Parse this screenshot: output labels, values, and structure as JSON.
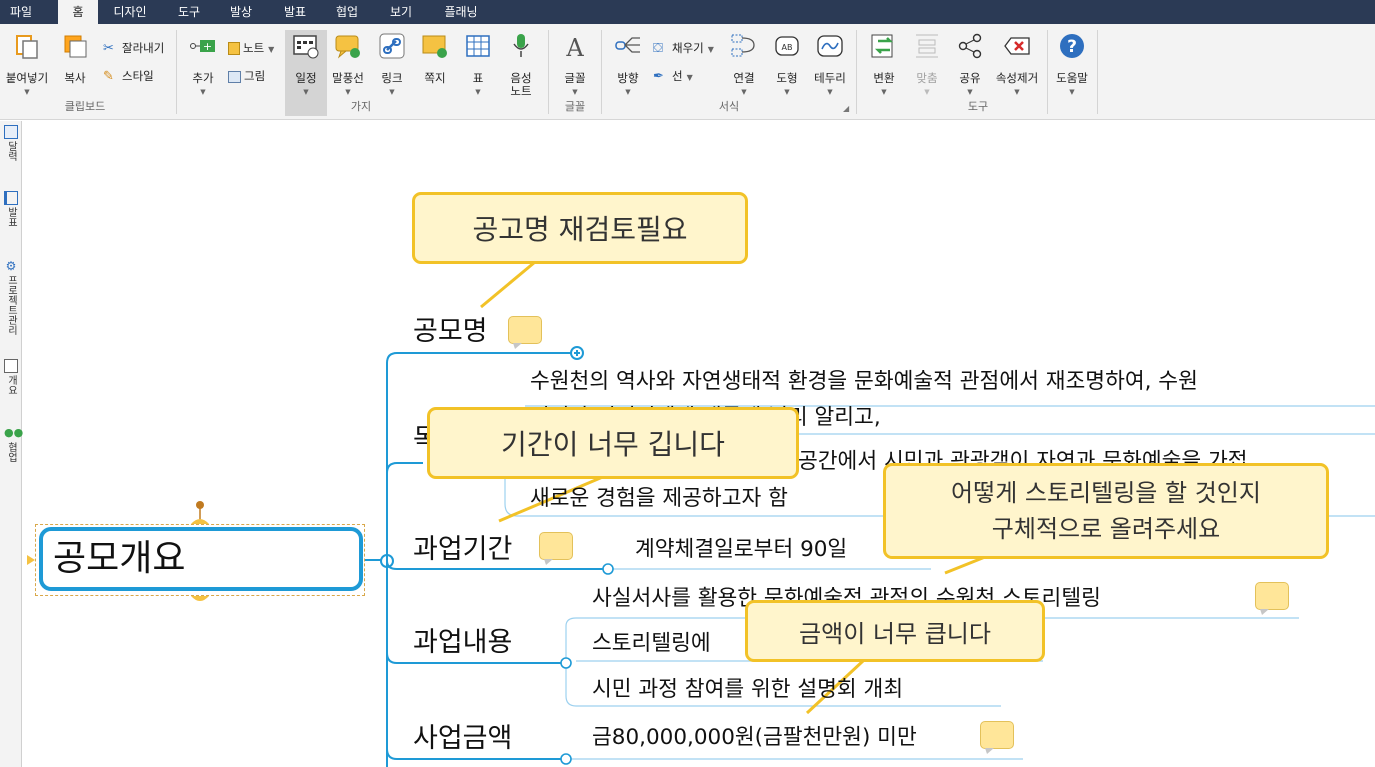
{
  "menu": {
    "tabs": [
      "파일",
      "홈",
      "디자인",
      "도구",
      "발상",
      "발표",
      "협업",
      "보기",
      "플래닝"
    ],
    "active": "홈"
  },
  "ribbon": {
    "clipboard": {
      "paste": "붙여넣기",
      "copy": "복사",
      "cut": "잘라내기",
      "style": "스타일",
      "group": "클립보드"
    },
    "branch": {
      "add": "추가",
      "note": "노트",
      "picture": "그림",
      "schedule": "일정",
      "callout": "말풍선",
      "link": "링크",
      "memo": "쪽지",
      "table": "표",
      "voice": "음성\n노트",
      "group": "가지"
    },
    "font": {
      "font": "글꼴",
      "group": "글꼴"
    },
    "format": {
      "direction": "방향",
      "fill": "채우기",
      "line": "선",
      "connect": "연결",
      "shape": "도형",
      "border": "테두리",
      "group": "서식"
    },
    "tools": {
      "convert": "변환",
      "fit": "맞춤",
      "share": "공유",
      "clear": "속성제거",
      "group": "도구"
    },
    "help": {
      "help": "도움말"
    }
  },
  "sidebar": [
    "달력",
    "발표",
    "프로젝트관리",
    "개요",
    "협업"
  ],
  "map": {
    "root": "공모개요",
    "branches": {
      "name": "공모명",
      "purpose": "목",
      "period": "과업기간",
      "content": "과업내용",
      "amount": "사업금액"
    },
    "leaves": {
      "purpose_1": "수원천의 역사와 자연생태적 환경을 문화예술적 관점에서 재조명하여, 수원",
      "purpose_1b": "시민과 외지인에게 새롭게 널리 알리고,",
      "purpose_2": "공간에서 시민과 관광객이 자연과 문화예술을 가접",
      "purpose_3": "새로운 경험을 제공하고자 함",
      "period_1": "계약체결일로부터 90일",
      "content_1": "사실서사를 활용한 문화예술적 관점의 수원천 스토리텔링",
      "content_2": "스토리텔링에",
      "content_3": "시민 과정 참여를 위한 설명회 개최",
      "amount_1": "금80,000,000원(금팔천만원) 미만"
    },
    "callouts": {
      "c1": "공고명 재검토필요",
      "c2": "기간이 너무 깁니다",
      "c3a": "어떻게 스토리텔링을 할 것인지",
      "c3b": "구체적으로 올려주세요",
      "c4": "금액이 너무 큽니다"
    }
  },
  "colors": {
    "menubar": "#2b3a55",
    "connector": "#1e9ad6",
    "callout_border": "#f2c227",
    "callout_fill": "#fff5cc",
    "note": "#ffe699"
  }
}
